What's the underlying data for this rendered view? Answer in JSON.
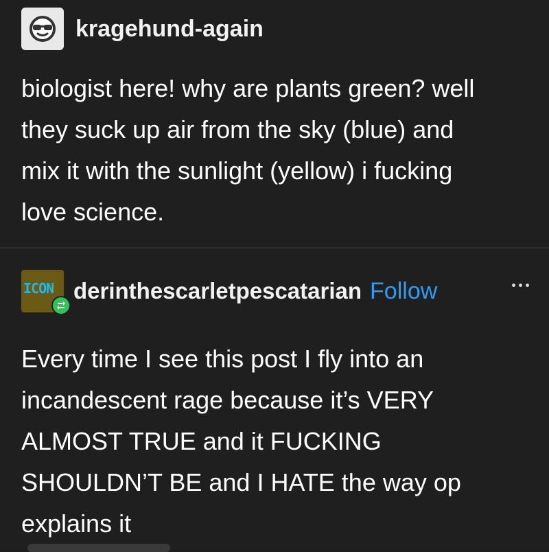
{
  "posts": [
    {
      "username": "kragehund-again",
      "avatar_icon": "sunglasses-face-icon",
      "body": "biologist here! why are plants green? well\nthey suck up air from the sky (blue) and\nmix it with the sunlight (yellow) i fucking\nlove science."
    },
    {
      "username": "derinthescarletpescatarian",
      "avatar_text": "ICON",
      "follow_label": "Follow",
      "body": "Every time I see this post I fly into an\nincandescent rage because it’s VERY\nALMOST TRUE and it FUCKING\nSHOULDN’T BE and I HATE the way op\nexplains it"
    }
  ],
  "colors": {
    "background": "#1f1f1f",
    "text": "#ffffff",
    "follow_link": "#2e9cf2",
    "reblog_badge": "#2bc653"
  }
}
